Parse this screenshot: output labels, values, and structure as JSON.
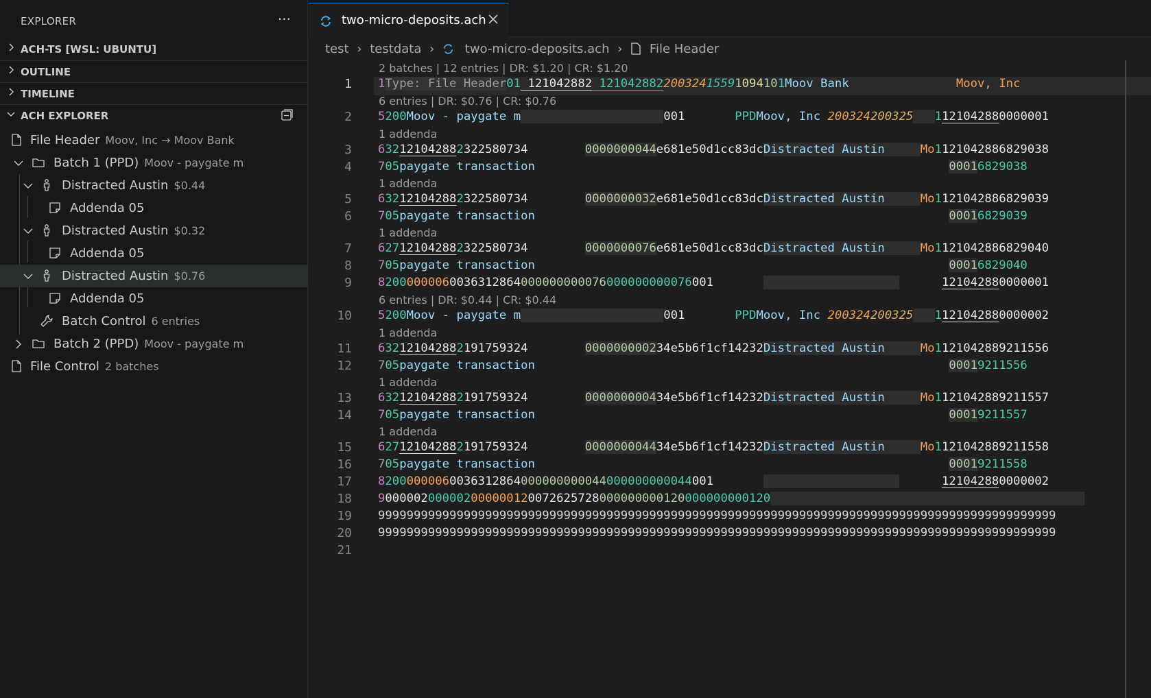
{
  "sidebar": {
    "title": "EXPLORER",
    "more": "···",
    "sections": [
      {
        "label": "ACH-TS [WSL: UBUNTU]"
      },
      {
        "label": "OUTLINE"
      },
      {
        "label": "TIMELINE"
      },
      {
        "label": "ACH EXPLORER"
      }
    ],
    "tree": [
      {
        "label": "File Header",
        "desc": "Moov, Inc → Moov Bank"
      },
      {
        "label": "Batch 1 (PPD)",
        "desc": "Moov - paygate m"
      },
      {
        "label": "Distracted Austin",
        "desc": "$0.44"
      },
      {
        "label": "Addenda 05",
        "desc": ""
      },
      {
        "label": "Distracted Austin",
        "desc": "$0.32"
      },
      {
        "label": "Addenda 05",
        "desc": ""
      },
      {
        "label": "Distracted Austin",
        "desc": "$0.76"
      },
      {
        "label": "Addenda 05",
        "desc": ""
      },
      {
        "label": "Batch Control",
        "desc": "6 entries"
      },
      {
        "label": "Batch 2 (PPD)",
        "desc": "Moov - paygate m"
      },
      {
        "label": "File Control",
        "desc": "2 batches"
      }
    ]
  },
  "tab": {
    "name": "two-micro-deposits.ach",
    "close": "✕"
  },
  "breadcrumb": [
    "test",
    "testdata",
    "two-micro-deposits.ach",
    "File Header"
  ],
  "lenses": {
    "file": "2 batches | 12 entries | DR: $1.20 | CR: $1.20",
    "batch1": "6 entries | DR: $0.76 | CR: $0.76",
    "batch2": "6 entries | DR: $0.44 | CR: $0.44",
    "addenda": "1 addenda"
  },
  "lines": {
    "n1": "1",
    "n2": "2",
    "n3": "3",
    "n4": "4",
    "n5": "5",
    "n6": "6",
    "n7": "7",
    "n8": "8",
    "n9": "9",
    "n10": "10",
    "n11": "11",
    "n12": "12",
    "n13": "13",
    "n14": "14",
    "n15": "15",
    "n16": "16",
    "n17": "17",
    "n18": "18",
    "n19": "19",
    "n20": "20",
    "n21": "21"
  },
  "code": {
    "l1": {
      "a": "1",
      "hint": "Type: File Header",
      "b": "01",
      "c": " 121042882",
      "d": " 121042882",
      "e": "200324",
      "f": "1559",
      "g": "1",
      "h": "094",
      "i": "10",
      "j": "1",
      "k": "Moov Bank",
      "l": "Moov, Inc"
    },
    "l2": {
      "a": "5",
      "b": "200",
      "c": "Moov - paygate m",
      "d": "001",
      "e": "PPD",
      "f": "Moov, Inc ",
      "g": "200324",
      "h": "200325",
      "i": "1",
      "j": "12104288",
      "k": "0000001"
    },
    "l3": {
      "a": "6",
      "b": "32",
      "c": "12104288",
      "d": "2",
      "e": "322580734",
      "f": "0000000044",
      "g": "e681e50d1cc83dc",
      "h": "Distracted Austin",
      "i": "Mo",
      "j": "1",
      "k": "121042886829038"
    },
    "l4": {
      "a": "7",
      "b": "05",
      "c": "paygate transaction",
      "d": "0001",
      "e": "6829038"
    },
    "l5": {
      "a": "6",
      "b": "32",
      "c": "12104288",
      "d": "2",
      "e": "322580734",
      "f": "0000000032",
      "g": "e681e50d1cc83dc",
      "h": "Distracted Austin",
      "i": "Mo",
      "j": "1",
      "k": "121042886829039"
    },
    "l6": {
      "a": "7",
      "b": "05",
      "c": "paygate transaction",
      "d": "0001",
      "e": "6829039"
    },
    "l7": {
      "a": "6",
      "b": "27",
      "c": "12104288",
      "d": "2",
      "e": "322580734",
      "f": "0000000076",
      "g": "e681e50d1cc83dc",
      "h": "Distracted Austin",
      "i": "Mo",
      "j": "1",
      "k": "121042886829040"
    },
    "l8": {
      "a": "7",
      "b": "05",
      "c": "paygate transaction",
      "d": "0001",
      "e": "6829040"
    },
    "l9": {
      "a": "8",
      "b": "200",
      "c": "000006",
      "d": "0036312864",
      "e": "000000000076",
      "f": "000000000076",
      "g": "001",
      "h": "12104288",
      "i": "0000001"
    },
    "l10": {
      "a": "5",
      "b": "200",
      "c": "Moov - paygate m",
      "d": "001",
      "e": "PPD",
      "f": "Moov, Inc ",
      "g": "200324",
      "h": "200325",
      "i": "1",
      "j": "12104288",
      "k": "0000002"
    },
    "l11": {
      "a": "6",
      "b": "32",
      "c": "12104288",
      "d": "2",
      "e": "191759324",
      "f": "0000000002",
      "g": "34e5b6f1cf14232",
      "h": "Distracted Austin",
      "i": "Mo",
      "j": "1",
      "k": "121042889211556"
    },
    "l12": {
      "a": "7",
      "b": "05",
      "c": "paygate transaction",
      "d": "0001",
      "e": "9211556"
    },
    "l13": {
      "a": "6",
      "b": "32",
      "c": "12104288",
      "d": "2",
      "e": "191759324",
      "f": "0000000004",
      "g": "34e5b6f1cf14232",
      "h": "Distracted Austin",
      "i": "Mo",
      "j": "1",
      "k": "121042889211557"
    },
    "l14": {
      "a": "7",
      "b": "05",
      "c": "paygate transaction",
      "d": "0001",
      "e": "9211557"
    },
    "l15": {
      "a": "6",
      "b": "27",
      "c": "12104288",
      "d": "2",
      "e": "191759324",
      "f": "0000000044",
      "g": "34e5b6f1cf14232",
      "h": "Distracted Austin",
      "i": "Mo",
      "j": "1",
      "k": "121042889211558"
    },
    "l16": {
      "a": "7",
      "b": "05",
      "c": "paygate transaction",
      "d": "0001",
      "e": "9211558"
    },
    "l17": {
      "a": "8",
      "b": "200",
      "c": "000006",
      "d": "0036312864",
      "e": "000000000044",
      "f": "000000000044",
      "g": "001",
      "h": "12104288",
      "i": "0000002"
    },
    "l18": {
      "a": "9",
      "b": "000002",
      "c": "000002",
      "d": "00000012",
      "e": "0072625728",
      "f": "000000000120",
      "g": "000000000120"
    },
    "l19": "99999999999999999999999999999999999999999999999999999999999999999999999999999999999999999999999",
    "l20": "99999999999999999999999999999999999999999999999999999999999999999999999999999999999999999999999"
  }
}
